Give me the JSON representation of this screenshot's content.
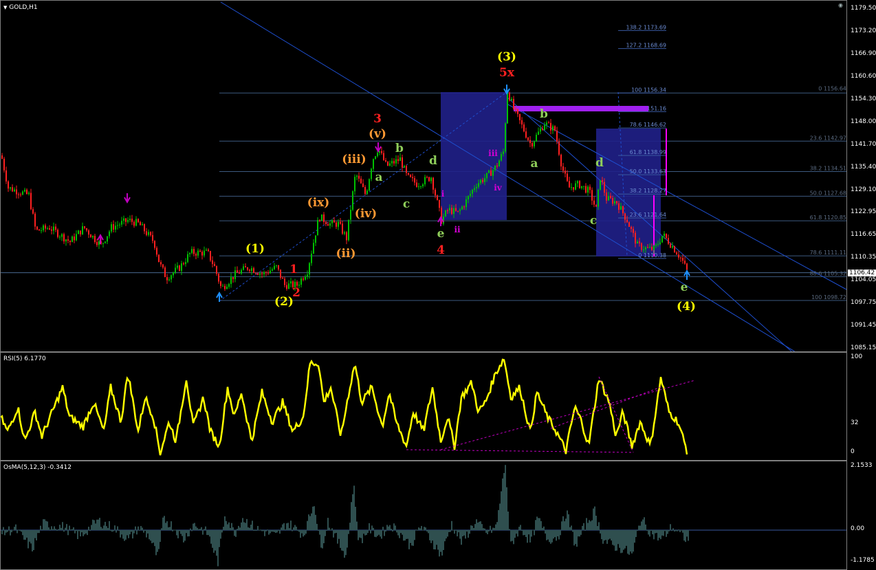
{
  "chart_header": {
    "symbol_label": "GOLD,H1"
  },
  "rsi_title": "RSI(5) 6.1770",
  "osma_title": "OsMA(5,12,3) -0.3412",
  "current_price": "1106.42",
  "price_axis": [
    "1179.50",
    "1173.20",
    "1166.90",
    "1160.60",
    "1154.30",
    "1148.00",
    "1141.70",
    "1135.40",
    "1129.10",
    "1122.95",
    "1116.65",
    "1110.35",
    "1104.05",
    "1097.75",
    "1091.45",
    "1085.15"
  ],
  "rsi_axis": [
    "100",
    "32",
    "0"
  ],
  "osma_axis": [
    "2.1533",
    "0.00",
    "-1.1785"
  ],
  "fib_left": [
    {
      "label": "100 1156.34",
      "price": 1156.34
    },
    {
      "label": "88.6 1151.16",
      "price": 1151.16
    },
    {
      "label": "78.6 1146.62",
      "price": 1146.62
    },
    {
      "label": "61.8 1138.99",
      "price": 1138.99
    },
    {
      "label": "50.0 1133.63",
      "price": 1133.63
    },
    {
      "label": "38.2 1128.27",
      "price": 1128.27
    },
    {
      "label": "23.6 1121.64",
      "price": 1121.64
    },
    {
      "label": "0 1110.38",
      "price": 1110.38
    },
    {
      "label": "138.2 1173.69",
      "price": 1173.69
    },
    {
      "label": "127.2 1168.69",
      "price": 1168.69
    }
  ],
  "fib_right": [
    {
      "label": "0 1156.64",
      "price": 1156.64
    },
    {
      "label": "23.6 1142.97",
      "price": 1142.97
    },
    {
      "label": "38.2 1134.51",
      "price": 1134.51
    },
    {
      "label": "50.0 1127.68",
      "price": 1127.68
    },
    {
      "label": "61.8 1120.85",
      "price": 1120.85
    },
    {
      "label": "78.6 1111.11",
      "price": 1111.11
    },
    {
      "label": "88.6 1105.32",
      "price": 1105.32
    },
    {
      "label": "100 1098.72",
      "price": 1098.72
    }
  ],
  "wave_labels": [
    {
      "text": "(1)",
      "color": "#ffff00",
      "x": 370,
      "y": 366
    },
    {
      "text": "(2)",
      "color": "#ffff00",
      "x": 412,
      "y": 443
    },
    {
      "text": "1",
      "color": "#ff2020",
      "x": 426,
      "y": 396
    },
    {
      "text": "2",
      "color": "#ff2020",
      "x": 430,
      "y": 430
    },
    {
      "text": "(ix)",
      "color": "#ff9933",
      "x": 462,
      "y": 299
    },
    {
      "text": "(ii)",
      "color": "#ff9933",
      "x": 502,
      "y": 373
    },
    {
      "text": "(iii)",
      "color": "#ff9933",
      "x": 514,
      "y": 236
    },
    {
      "text": "(iv)",
      "color": "#ff9933",
      "x": 531,
      "y": 315
    },
    {
      "text": "(v)",
      "color": "#ff9933",
      "x": 548,
      "y": 199
    },
    {
      "text": "3",
      "color": "#ff2020",
      "x": 548,
      "y": 177
    },
    {
      "text": "a",
      "color": "#8fce5a",
      "x": 550,
      "y": 262
    },
    {
      "text": "b",
      "color": "#8fce5a",
      "x": 580,
      "y": 220
    },
    {
      "text": "c",
      "color": "#8fce5a",
      "x": 590,
      "y": 301
    },
    {
      "text": "d",
      "color": "#8fce5a",
      "x": 629,
      "y": 238
    },
    {
      "text": "e",
      "color": "#8fce5a",
      "x": 640,
      "y": 344
    },
    {
      "text": "4",
      "color": "#ff2020",
      "x": 640,
      "y": 368
    },
    {
      "text": "i",
      "color": "#d400d4",
      "x": 643,
      "y": 285
    },
    {
      "text": "ii",
      "color": "#d400d4",
      "x": 664,
      "y": 337
    },
    {
      "text": "iii",
      "color": "#d400d4",
      "x": 716,
      "y": 226
    },
    {
      "text": "iv",
      "color": "#d400d4",
      "x": 723,
      "y": 276
    },
    {
      "text": "(3)",
      "color": "#ffff00",
      "x": 736,
      "y": 87
    },
    {
      "text": "5x",
      "color": "#ff2020",
      "x": 736,
      "y": 110
    },
    {
      "text": "b",
      "color": "#8fce5a",
      "x": 790,
      "y": 170
    },
    {
      "text": "a",
      "color": "#8fce5a",
      "x": 776,
      "y": 242
    },
    {
      "text": "d",
      "color": "#8fce5a",
      "x": 871,
      "y": 241
    },
    {
      "text": "c",
      "color": "#8fce5a",
      "x": 862,
      "y": 325
    },
    {
      "text": "e",
      "color": "#8fce5a",
      "x": 994,
      "y": 422
    },
    {
      "text": "(4)",
      "color": "#ffff00",
      "x": 997,
      "y": 450
    }
  ],
  "colors": {
    "bull": "#00c000",
    "bear": "#ff2020",
    "rsi": "#ffff00",
    "osma": "#2f4f4f",
    "channel": "#1e4fd0",
    "fib": "#3d5a80",
    "box": "#20208a",
    "magenta": "#a020f0"
  },
  "chart_data": {
    "type": "candlestick",
    "title": "GOLD,H1",
    "ylim": [
      1085.15,
      1179.5
    ],
    "anchors": [
      [
        0,
        1139
      ],
      [
        10,
        1130
      ],
      [
        40,
        1128
      ],
      [
        50,
        1118
      ],
      [
        70,
        1119
      ],
      [
        100,
        1115
      ],
      [
        120,
        1119
      ],
      [
        145,
        1114
      ],
      [
        160,
        1119
      ],
      [
        185,
        1121
      ],
      [
        200,
        1120
      ],
      [
        222,
        1115
      ],
      [
        230,
        1109
      ],
      [
        240,
        1105
      ],
      [
        260,
        1108
      ],
      [
        275,
        1112
      ],
      [
        300,
        1112
      ],
      [
        310,
        1108
      ],
      [
        320,
        1102
      ],
      [
        340,
        1106
      ],
      [
        360,
        1108
      ],
      [
        380,
        1106
      ],
      [
        400,
        1108
      ],
      [
        412,
        1103
      ],
      [
        430,
        1103
      ],
      [
        445,
        1107
      ],
      [
        462,
        1122
      ],
      [
        478,
        1120
      ],
      [
        490,
        1120
      ],
      [
        502,
        1116
      ],
      [
        515,
        1134
      ],
      [
        530,
        1128
      ],
      [
        540,
        1138
      ],
      [
        548,
        1141
      ],
      [
        560,
        1136
      ],
      [
        580,
        1138
      ],
      [
        590,
        1133
      ],
      [
        605,
        1131
      ],
      [
        625,
        1133
      ],
      [
        640,
        1121
      ],
      [
        650,
        1124
      ],
      [
        664,
        1123
      ],
      [
        675,
        1126
      ],
      [
        690,
        1131
      ],
      [
        705,
        1133
      ],
      [
        720,
        1136
      ],
      [
        730,
        1140
      ],
      [
        736,
        1157
      ],
      [
        745,
        1152
      ],
      [
        760,
        1146
      ],
      [
        770,
        1142
      ],
      [
        790,
        1148
      ],
      [
        805,
        1146
      ],
      [
        815,
        1136
      ],
      [
        825,
        1130
      ],
      [
        840,
        1131
      ],
      [
        855,
        1129
      ],
      [
        865,
        1124
      ],
      [
        871,
        1133
      ],
      [
        880,
        1127
      ],
      [
        895,
        1126
      ],
      [
        910,
        1121
      ],
      [
        925,
        1114
      ],
      [
        940,
        1113
      ],
      [
        950,
        1113
      ],
      [
        962,
        1117
      ],
      [
        975,
        1114
      ],
      [
        990,
        1110
      ],
      [
        999,
        1106
      ]
    ],
    "rsi_anchors": [
      [
        0,
        40
      ],
      [
        10,
        25
      ],
      [
        25,
        50
      ],
      [
        35,
        15
      ],
      [
        50,
        45
      ],
      [
        60,
        20
      ],
      [
        75,
        45
      ],
      [
        90,
        70
      ],
      [
        100,
        40
      ],
      [
        120,
        30
      ],
      [
        135,
        55
      ],
      [
        150,
        25
      ],
      [
        160,
        70
      ],
      [
        175,
        35
      ],
      [
        185,
        85
      ],
      [
        200,
        25
      ],
      [
        210,
        60
      ],
      [
        222,
        40
      ],
      [
        232,
        3
      ],
      [
        245,
        35
      ],
      [
        255,
        15
      ],
      [
        270,
        80
      ],
      [
        280,
        30
      ],
      [
        295,
        60
      ],
      [
        305,
        25
      ],
      [
        318,
        10
      ],
      [
        330,
        70
      ],
      [
        340,
        40
      ],
      [
        350,
        65
      ],
      [
        365,
        15
      ],
      [
        380,
        65
      ],
      [
        395,
        35
      ],
      [
        410,
        55
      ],
      [
        425,
        25
      ],
      [
        440,
        40
      ],
      [
        450,
        95
      ],
      [
        462,
        95
      ],
      [
        470,
        55
      ],
      [
        480,
        70
      ],
      [
        495,
        20
      ],
      [
        505,
        60
      ],
      [
        515,
        95
      ],
      [
        525,
        55
      ],
      [
        540,
        70
      ],
      [
        555,
        30
      ],
      [
        565,
        65
      ],
      [
        575,
        35
      ],
      [
        590,
        10
      ],
      [
        600,
        45
      ],
      [
        615,
        25
      ],
      [
        628,
        70
      ],
      [
        640,
        15
      ],
      [
        650,
        40
      ],
      [
        660,
        10
      ],
      [
        670,
        60
      ],
      [
        685,
        75
      ],
      [
        695,
        45
      ],
      [
        705,
        55
      ],
      [
        720,
        85
      ],
      [
        732,
        100
      ],
      [
        742,
        60
      ],
      [
        755,
        70
      ],
      [
        770,
        25
      ],
      [
        780,
        65
      ],
      [
        795,
        40
      ],
      [
        808,
        25
      ],
      [
        822,
        5
      ],
      [
        835,
        50
      ],
      [
        845,
        35
      ],
      [
        855,
        10
      ],
      [
        870,
        80
      ],
      [
        885,
        55
      ],
      [
        895,
        20
      ],
      [
        905,
        45
      ],
      [
        918,
        10
      ],
      [
        930,
        35
      ],
      [
        945,
        10
      ],
      [
        960,
        80
      ],
      [
        972,
        45
      ],
      [
        985,
        35
      ],
      [
        999,
        3
      ]
    ],
    "osma_anchors": [
      [
        0,
        -0.1
      ],
      [
        20,
        0.05
      ],
      [
        45,
        -0.6
      ],
      [
        60,
        0.2
      ],
      [
        90,
        0.1
      ],
      [
        115,
        -0.2
      ],
      [
        140,
        0.3
      ],
      [
        165,
        0.05
      ],
      [
        185,
        -0.3
      ],
      [
        200,
        0.1
      ],
      [
        215,
        -0.2
      ],
      [
        228,
        -0.9
      ],
      [
        236,
        0.4
      ],
      [
        250,
        0.1
      ],
      [
        265,
        -0.3
      ],
      [
        280,
        0.2
      ],
      [
        300,
        -0.1
      ],
      [
        315,
        -1.0
      ],
      [
        325,
        0.5
      ],
      [
        340,
        -0.1
      ],
      [
        350,
        0.4
      ],
      [
        370,
        0.05
      ],
      [
        400,
        -0.2
      ],
      [
        415,
        0.25
      ],
      [
        440,
        -0.15
      ],
      [
        455,
        0.9
      ],
      [
        465,
        -0.6
      ],
      [
        475,
        0.3
      ],
      [
        490,
        -0.4
      ],
      [
        502,
        -0.8
      ],
      [
        512,
        1.5
      ],
      [
        520,
        -0.4
      ],
      [
        535,
        0.05
      ],
      [
        550,
        -0.2
      ],
      [
        565,
        0.2
      ],
      [
        580,
        -0.1
      ],
      [
        595,
        -0.5
      ],
      [
        610,
        0.15
      ],
      [
        625,
        -0.3
      ],
      [
        640,
        -0.8
      ],
      [
        655,
        0.2
      ],
      [
        670,
        -0.4
      ],
      [
        690,
        0.3
      ],
      [
        705,
        -0.1
      ],
      [
        720,
        0.1
      ],
      [
        733,
        2.15
      ],
      [
        740,
        -0.5
      ],
      [
        755,
        0.1
      ],
      [
        770,
        -0.4
      ],
      [
        780,
        0.4
      ],
      [
        795,
        -0.3
      ],
      [
        810,
        -0.2
      ],
      [
        822,
        0.6
      ],
      [
        835,
        -0.5
      ],
      [
        850,
        0.2
      ],
      [
        863,
        0.6
      ],
      [
        875,
        -0.3
      ],
      [
        890,
        -0.5
      ],
      [
        905,
        -0.6
      ],
      [
        918,
        -0.8
      ],
      [
        930,
        0.4
      ],
      [
        945,
        -0.1
      ],
      [
        960,
        -0.3
      ],
      [
        975,
        0.1
      ],
      [
        999,
        -0.34
      ]
    ],
    "series": [
      {
        "name": "RSI(5)",
        "last": 6.177
      },
      {
        "name": "OsMA(5,12,3)",
        "last": -0.3412
      }
    ]
  }
}
